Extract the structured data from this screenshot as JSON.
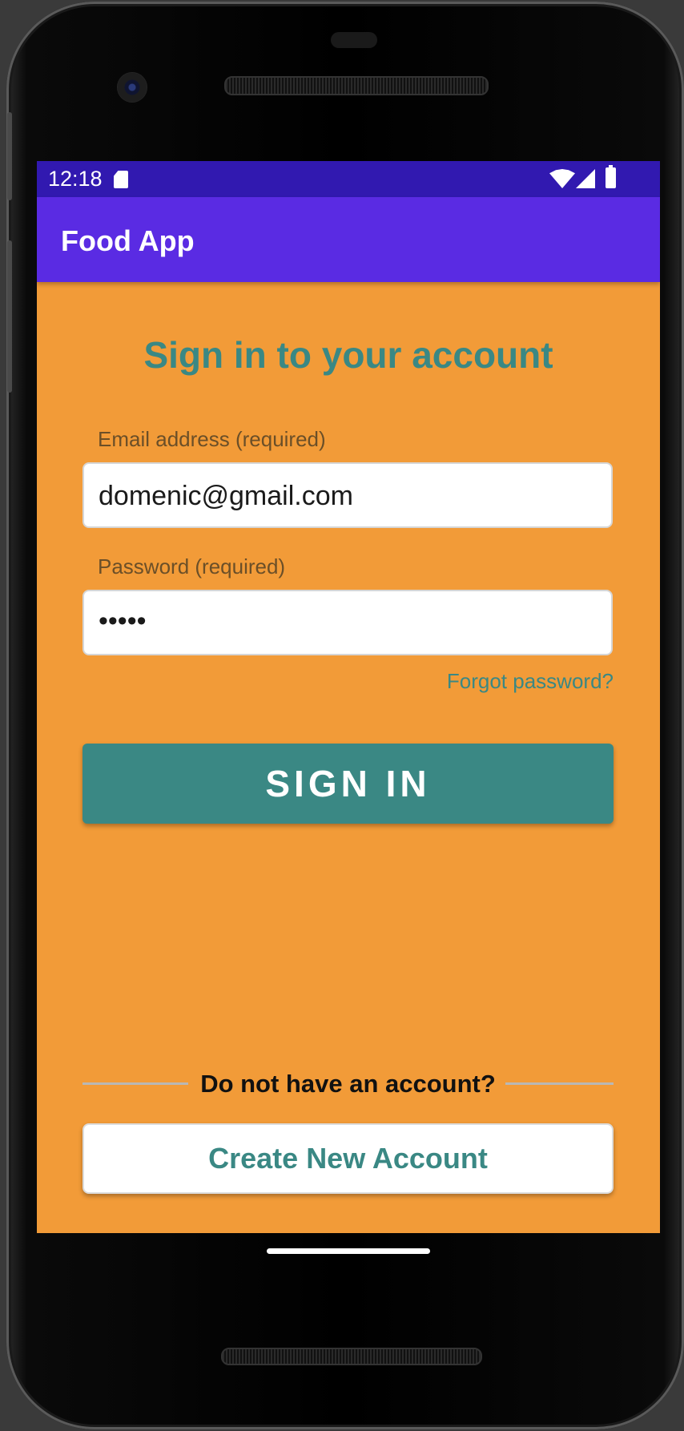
{
  "status_bar": {
    "time": "12:18",
    "icons": [
      "sd-card-icon",
      "wifi-icon",
      "signal-icon",
      "battery-icon"
    ],
    "color": "#3119b0"
  },
  "app_bar": {
    "title": "Food App",
    "color": "#5a2be3"
  },
  "main": {
    "heading": "Sign in to your account",
    "email": {
      "label": "Email address (required)",
      "value": "domenic@gmail.com"
    },
    "password": {
      "label": "Password (required)",
      "value": "•••••"
    },
    "forgot_password": "Forgot password?",
    "sign_in_label": "SIGN IN",
    "no_account_text": "Do not have an account?",
    "create_account_label": "Create New Account",
    "background_color": "#f29b38",
    "accent_color": "#3a8884"
  }
}
